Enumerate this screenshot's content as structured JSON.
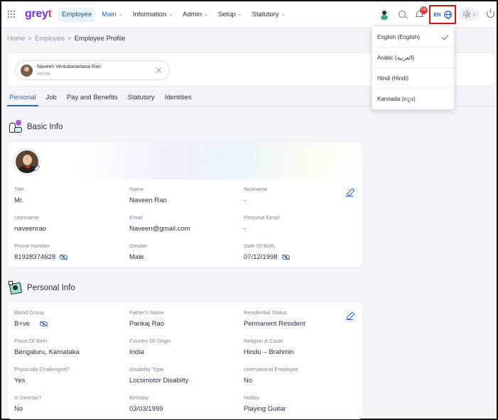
{
  "brand": {
    "logo_text": "grey",
    "logo_accent": "t",
    "accent_color": "#2b63c7",
    "brand_color": "#7a2fd6"
  },
  "nav": {
    "items": [
      {
        "label": "Employee",
        "active": true
      },
      {
        "label": "Main",
        "has_dropdown": true,
        "highlight": true
      },
      {
        "label": "Information",
        "has_dropdown": true
      },
      {
        "label": "Admin",
        "has_dropdown": true
      },
      {
        "label": "Setup",
        "has_dropdown": true
      },
      {
        "label": "Statutory",
        "has_dropdown": true
      }
    ]
  },
  "header_right": {
    "notification_count": "03",
    "language_code": "EN",
    "icons": [
      "user-avatar",
      "search-icon",
      "bell-icon",
      "globe-icon",
      "gear-icon",
      "power-icon"
    ]
  },
  "breadcrumb": {
    "home": "Home",
    "sep": ">",
    "section": "Employee",
    "current": "Employee Profile"
  },
  "employee_selector": {
    "name": "Naveen Venkataramana Rao",
    "id": "#0034"
  },
  "tabs": [
    {
      "label": "Personal",
      "active": true
    },
    {
      "label": "Job"
    },
    {
      "label": "Pay and Benefits"
    },
    {
      "label": "Statutory"
    },
    {
      "label": "Identities"
    }
  ],
  "basic_info": {
    "title": "Basic Info",
    "fields": [
      {
        "label": "Title",
        "value": "Mr."
      },
      {
        "label": "Name",
        "value": "Naveen Rao"
      },
      {
        "label": "Nickname",
        "value": "-"
      },
      {
        "label": "Username",
        "value": "naveenrao"
      },
      {
        "label": "Email",
        "value": "Naveen@gmail.com"
      },
      {
        "label": "Personal Email",
        "value": "-"
      },
      {
        "label": "Phone Number",
        "value": "81928374628",
        "masked_toggle": true
      },
      {
        "label": "Gender",
        "value": "Male"
      },
      {
        "label": "Date Of Birth",
        "value": "07/12/1998",
        "masked_toggle": true
      }
    ]
  },
  "personal_info": {
    "title": "Personal Info",
    "fields": [
      {
        "label": "Blood Group",
        "value": "B+ve",
        "masked_toggle": true
      },
      {
        "label": "Father's Name",
        "value": "Pankaj Rao"
      },
      {
        "label": "Residential Status",
        "value": "Permanent Resident"
      },
      {
        "label": "Place Of Birth",
        "value": "Bengaluru, Karnataka"
      },
      {
        "label": "Country Of Origin",
        "value": "India"
      },
      {
        "label": "Religion & Caste",
        "value": "Hindu – Brahmin"
      },
      {
        "label": "Physically Challenged?",
        "value": "Yes"
      },
      {
        "label": "Disability Type",
        "value": "Locomotor Disabilty"
      },
      {
        "label": "International Employee",
        "value": "No"
      },
      {
        "label": "Is Director?",
        "value": "No"
      },
      {
        "label": "Birthday",
        "value": "03/03/1999"
      },
      {
        "label": "Hobby",
        "value": "Playing Guitar"
      }
    ]
  },
  "language_menu": {
    "options": [
      {
        "label": "English (English)",
        "selected": true
      },
      {
        "label": "Arabic (العربية)"
      },
      {
        "label": "Hindi (Hindi)"
      },
      {
        "label": "Kannada (ಕನ್ನಡ)"
      }
    ]
  }
}
